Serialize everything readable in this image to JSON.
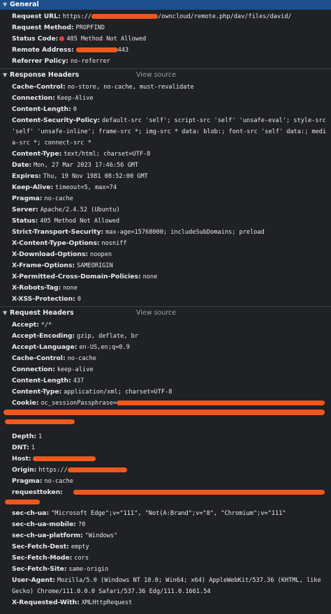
{
  "general": {
    "title": "General",
    "rows": [
      {
        "key": "Request URL:",
        "value_pre": "https://",
        "value_post": "/owncloud/remote.php/dav/files/david/"
      },
      {
        "key": "Request Method:",
        "value": "PROPFIND"
      },
      {
        "key": "Status Code:",
        "value": "405 Method Not Allowed"
      },
      {
        "key": "Remote Address:",
        "value_post": "443"
      },
      {
        "key": "Referrer Policy:",
        "value": "no-referrer"
      }
    ]
  },
  "response": {
    "title": "Response Headers",
    "view_source": "View source",
    "rows": [
      {
        "key": "Cache-Control:",
        "value": "no-store, no-cache, must-revalidate"
      },
      {
        "key": "Connection:",
        "value": "Keep-Alive"
      },
      {
        "key": "Content-Length:",
        "value": "0"
      },
      {
        "key": "Content-Security-Policy:",
        "value": "default-src 'self'; script-src 'self' 'unsafe-eval'; style-src 'self' 'unsafe-inline'; frame-src *; img-src * data: blob:; font-src 'self' data:; media-src *; connect-src *"
      },
      {
        "key": "Content-Type:",
        "value": "text/html; charset=UTF-8"
      },
      {
        "key": "Date:",
        "value": "Mon, 27 Mar 2023 17:46:56 GMT"
      },
      {
        "key": "Expires:",
        "value": "Thu, 19 Nov 1981 08:52:00 GMT"
      },
      {
        "key": "Keep-Alive:",
        "value": "timeout=5, max=74"
      },
      {
        "key": "Pragma:",
        "value": "no-cache"
      },
      {
        "key": "Server:",
        "value": "Apache/2.4.52 (Ubuntu)"
      },
      {
        "key": "Status:",
        "value": "405 Method Not Allowed"
      },
      {
        "key": "Strict-Transport-Security:",
        "value": "max-age=15768000; includeSubDomains; preload"
      },
      {
        "key": "X-Content-Type-Options:",
        "value": "nosniff"
      },
      {
        "key": "X-Download-Options:",
        "value": "noopen"
      },
      {
        "key": "X-Frame-Options:",
        "value": "SAMEORIGIN"
      },
      {
        "key": "X-Permitted-Cross-Domain-Policies:",
        "value": "none"
      },
      {
        "key": "X-Robots-Tag:",
        "value": "none"
      },
      {
        "key": "X-XSS-Protection:",
        "value": "0"
      }
    ]
  },
  "request": {
    "title": "Request Headers",
    "view_source": "View source",
    "rows": [
      {
        "key": "Accept:",
        "value": "*/*"
      },
      {
        "key": "Accept-Encoding:",
        "value": "gzip, deflate, br"
      },
      {
        "key": "Accept-Language:",
        "value": "en-US,en;q=0.9"
      },
      {
        "key": "Cache-Control:",
        "value": "no-cache"
      },
      {
        "key": "Connection:",
        "value": "keep-alive"
      },
      {
        "key": "Content-Length:",
        "value": "437"
      },
      {
        "key": "Content-Type:",
        "value": "application/xml; charset=UTF-8"
      },
      {
        "key": "Cookie:",
        "value": "oc_sessionPassphrase="
      },
      {
        "key": "Depth:",
        "value": "1"
      },
      {
        "key": "DNT:",
        "value": "1"
      },
      {
        "key": "Host:",
        "value": ""
      },
      {
        "key": "Origin:",
        "value": "https://"
      },
      {
        "key": "Pragma:",
        "value": "no-cache"
      },
      {
        "key": "requesttoken:",
        "value": ""
      },
      {
        "key": "sec-ch-ua:",
        "value": "\"Microsoft Edge\";v=\"111\", \"Not(A:Brand\";v=\"8\", \"Chromium\";v=\"111\""
      },
      {
        "key": "sec-ch-ua-mobile:",
        "value": "?0"
      },
      {
        "key": "sec-ch-ua-platform:",
        "value": "\"Windows\""
      },
      {
        "key": "Sec-Fetch-Dest:",
        "value": "empty"
      },
      {
        "key": "Sec-Fetch-Mode:",
        "value": "cors"
      },
      {
        "key": "Sec-Fetch-Site:",
        "value": "same-origin"
      },
      {
        "key": "User-Agent:",
        "value": "Mozilla/5.0 (Windows NT 10.0; Win64; x64) AppleWebKit/537.36 (KHTML, like Gecko) Chrome/111.0.0.0 Safari/537.36 Edg/111.0.1661.54"
      },
      {
        "key": "X-Requested-With:",
        "value": "XMLHttpRequest"
      }
    ]
  },
  "colors": {
    "general_header": "#1c4f8c",
    "redaction": "#f2581d",
    "status_dot": "#e8403c",
    "background": "#202124"
  }
}
